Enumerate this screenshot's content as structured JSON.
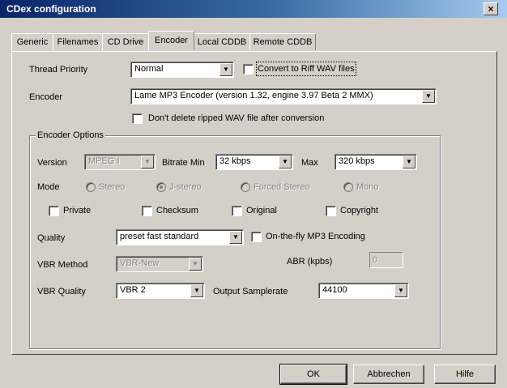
{
  "window": {
    "title": "CDex configuration",
    "close_glyph": "×"
  },
  "tabs": [
    {
      "label": "Generic"
    },
    {
      "label": "Filenames"
    },
    {
      "label": "CD Drive"
    },
    {
      "label": "Encoder",
      "active": true
    },
    {
      "label": "Local CDDB"
    },
    {
      "label": "Remote CDDB"
    }
  ],
  "thread_priority": {
    "label": "Thread Priority",
    "value": "Normal"
  },
  "convert_riff": {
    "label": "Convert to Riff WAV files",
    "checked": false
  },
  "encoder": {
    "label": "Encoder",
    "value": "Lame MP3 Encoder (version 1.32, engine 3.97 Beta 2 MMX)"
  },
  "dont_delete": {
    "label": "Don't delete ripped WAV file after conversion",
    "checked": false
  },
  "encoder_options": {
    "title": "Encoder Options",
    "version": {
      "label": "Version",
      "value": "MPEG I"
    },
    "bitrate_min": {
      "label": "Bitrate Min",
      "value": "32 kbps"
    },
    "bitrate_max": {
      "label": "Max",
      "value": "320 kbps"
    },
    "mode": {
      "label": "Mode",
      "options": [
        "Stereo",
        "J-stereo",
        "Forced Stereo",
        "Mono"
      ],
      "selected": "J-stereo"
    },
    "checkboxes": [
      {
        "label": "Private",
        "checked": false
      },
      {
        "label": "Checksum",
        "checked": false
      },
      {
        "label": "Original",
        "checked": false
      },
      {
        "label": "Copyright",
        "checked": false
      }
    ],
    "quality": {
      "label": "Quality",
      "value": "preset fast standard"
    },
    "on_the_fly": {
      "label": "On-the-fly MP3 Encoding",
      "checked": false
    },
    "vbr_method": {
      "label": "VBR Method",
      "value": "VBR-New"
    },
    "abr": {
      "label": "ABR (kpbs)",
      "value": "0"
    },
    "vbr_quality": {
      "label": "VBR Quality",
      "value": "VBR 2"
    },
    "output_samplerate": {
      "label": "Output Samplerate",
      "value": "44100"
    }
  },
  "buttons": {
    "ok": "OK",
    "cancel": "Abbrechen",
    "help": "Hilfe"
  },
  "icons": {
    "dropdown_arrow": "▼"
  }
}
